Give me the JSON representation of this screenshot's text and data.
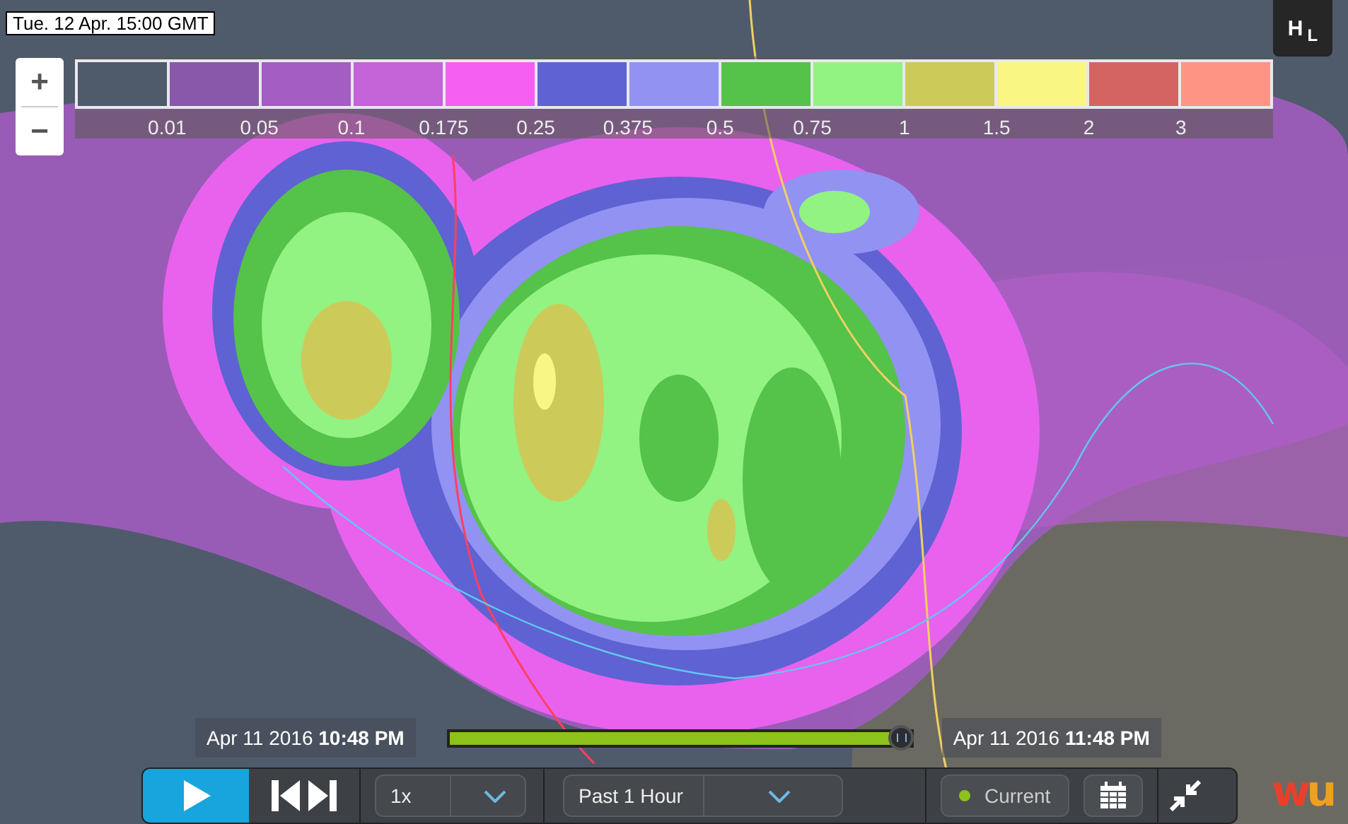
{
  "timestamp": "Tue. 12 Apr. 15:00 GMT",
  "zoom": {
    "zoom_in": "+",
    "zoom_out": "−"
  },
  "legend": {
    "swatches": [
      {
        "color": "#4f5b6b"
      },
      {
        "color": "#8a58aa"
      },
      {
        "color": "#a45dc2"
      },
      {
        "color": "#c462d8"
      },
      {
        "color": "#f55ff2"
      },
      {
        "color": "#5f62d2"
      },
      {
        "color": "#9292f2"
      },
      {
        "color": "#55c24a"
      },
      {
        "color": "#92f282"
      },
      {
        "color": "#cccb5a"
      },
      {
        "color": "#faf684"
      },
      {
        "color": "#d46462"
      },
      {
        "color": "#fd9484"
      }
    ],
    "labels": [
      "0.01",
      "0.05",
      "0.1",
      "0.175",
      "0.25",
      "0.375",
      "0.5",
      "0.75",
      "1",
      "1.5",
      "2",
      "3"
    ]
  },
  "layer_toggle": {
    "letter_1": "H",
    "letter_2": "L"
  },
  "timeline": {
    "start": "Apr 11 2016 **10:48 PM**",
    "end": "Apr 11 2016 **11:48 PM**",
    "level": 0.98
  },
  "controls": {
    "speed": {
      "value": "1x"
    },
    "range": {
      "value": "Past 1 Hour"
    },
    "current": {
      "label": "Current",
      "on": true
    }
  },
  "logo": {
    "letter_1": "w",
    "letter_2": "u"
  }
}
